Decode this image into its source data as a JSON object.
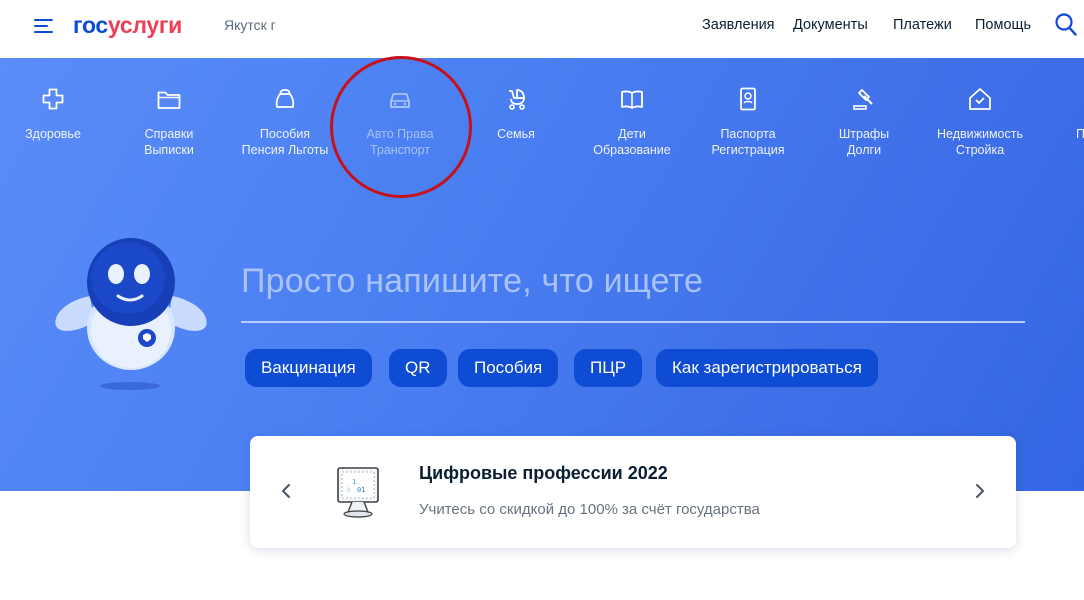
{
  "header": {
    "logo_part1": "гос",
    "logo_part2": "услуги",
    "city": "Якутск г",
    "nav": [
      "Заявления",
      "Документы",
      "Платежи",
      "Помощь"
    ]
  },
  "categories": [
    {
      "line1": "Здоровье",
      "line2": "",
      "icon": "health-cross-icon"
    },
    {
      "line1": "Справки",
      "line2": "Выписки",
      "icon": "folder-icon"
    },
    {
      "line1": "Пособия",
      "line2": "Пенсия Льготы",
      "icon": "wallet-bag-icon"
    },
    {
      "line1": "Авто Права",
      "line2": "Транспорт",
      "icon": "car-icon"
    },
    {
      "line1": "Семья",
      "line2": "",
      "icon": "stroller-icon"
    },
    {
      "line1": "Дети",
      "line2": "Образование",
      "icon": "book-icon"
    },
    {
      "line1": "Паспорта",
      "line2": "Регистрация",
      "icon": "passport-icon"
    },
    {
      "line1": "Штрафы",
      "line2": "Долги",
      "icon": "gavel-icon"
    },
    {
      "line1": "Недвижимость",
      "line2": "Стройка",
      "icon": "house-icon"
    },
    {
      "line1": "П",
      "line2": "",
      "icon": "more-category-icon"
    }
  ],
  "search": {
    "placeholder": "Просто напишите, что ищете"
  },
  "chips": [
    "Вакцинация",
    "QR",
    "Пособия",
    "ПЦР",
    "Как зарегистрироваться"
  ],
  "promo": {
    "title": "Цифровые профессии 2022",
    "subtitle": "Учитесь со скидкой до 100% за счёт государства"
  },
  "colors": {
    "brand_blue": "#0d4cd3",
    "brand_red": "#ee3f58",
    "hero_blue": "#4a7ff2",
    "annotation_red": "#c6111a"
  }
}
